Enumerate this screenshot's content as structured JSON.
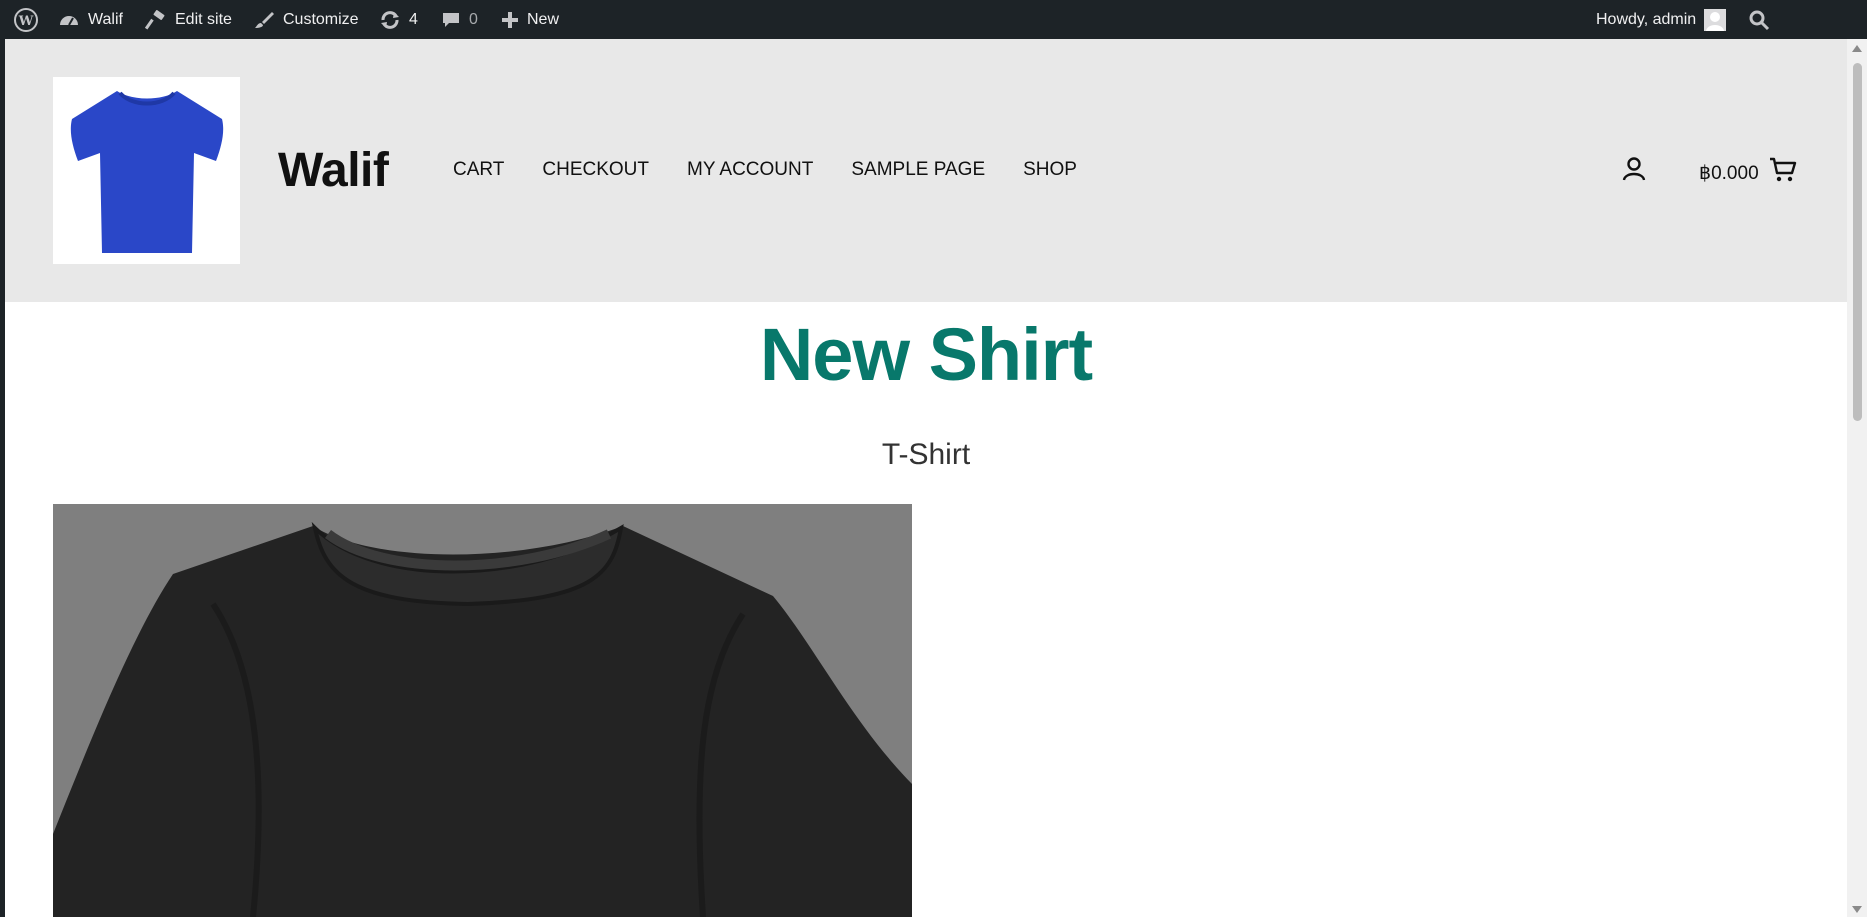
{
  "adminbar": {
    "site_name": "Walif",
    "edit_site": "Edit site",
    "customize": "Customize",
    "updates_count": "4",
    "comments_count": "0",
    "new_label": "New",
    "howdy": "Howdy, admin"
  },
  "header": {
    "site_title": "Walif",
    "nav": [
      {
        "label": "CART"
      },
      {
        "label": "CHECKOUT"
      },
      {
        "label": "MY ACCOUNT"
      },
      {
        "label": "SAMPLE PAGE"
      },
      {
        "label": "SHOP"
      }
    ],
    "cart_amount": "฿0.000"
  },
  "main": {
    "title": "New Shirt",
    "subtitle": "T-Shirt"
  },
  "colors": {
    "adminbar_bg": "#1d2327",
    "header_bg": "#e8e8e8",
    "title_color": "#08786b",
    "logo_shirt": "#2a47c8",
    "product_shirt": "#232323"
  },
  "icons": [
    "wordpress-icon",
    "dashboard-icon",
    "hammer-icon",
    "paintbrush-icon",
    "refresh-icon",
    "comment-icon",
    "plus-icon",
    "avatar-icon",
    "search-icon",
    "user-account-icon",
    "cart-icon"
  ]
}
